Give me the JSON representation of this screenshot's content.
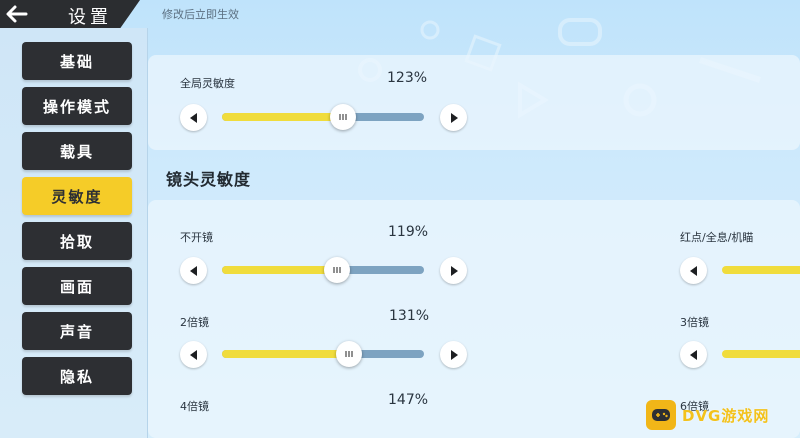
{
  "header": {
    "title": "设置",
    "hint": "修改后立即生效"
  },
  "sidebar": {
    "items": [
      {
        "label": "基础"
      },
      {
        "label": "操作模式"
      },
      {
        "label": "载具"
      },
      {
        "label": "灵敏度",
        "active": true
      },
      {
        "label": "拾取"
      },
      {
        "label": "画面"
      },
      {
        "label": "声音"
      },
      {
        "label": "隐私"
      }
    ]
  },
  "global": {
    "label": "全局灵敏度",
    "value_text": "123%",
    "level": 0.6
  },
  "lens": {
    "section_title": "镜头灵敏度",
    "left": [
      {
        "label": "不开镜",
        "value_text": "119%",
        "level": 0.57
      },
      {
        "label": "2倍镜",
        "value_text": "131%",
        "level": 0.63
      },
      {
        "label": "4倍镜",
        "value_text": "147%"
      }
    ],
    "right": [
      {
        "label": "红点/全息/机瞄"
      },
      {
        "label": "3倍镜"
      },
      {
        "label": "6倍镜"
      }
    ]
  },
  "watermark": {
    "text": "DVG游戏网"
  },
  "colors": {
    "nav_bg": "#2d2f33",
    "nav_active": "#f5cc28",
    "slider_fill": "#f0dc3c",
    "slider_track": "#7da3c1"
  }
}
